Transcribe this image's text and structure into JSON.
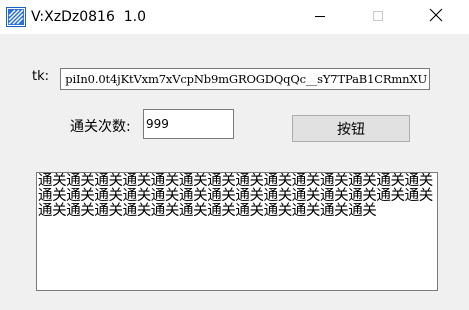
{
  "window": {
    "title": "V:XzDz0816  1.0",
    "icon": "app-icon",
    "controls": {
      "minimize_icon": "minimize-icon",
      "maximize_icon": "maximize-icon",
      "close_icon": "close-icon"
    }
  },
  "form": {
    "tk_label": "tk:",
    "tk_value": "piIn0.0t4jKtVxm7xVcpNb9mGROGDQqQc__sY7TPaB1CRmnXU",
    "count_label": "通关次数:",
    "count_value": "999",
    "button_label": "按钮"
  },
  "output": {
    "text": "通关通关通关通关通关通关通关通关通关通关通关通关通关通关通关通关通关通关通关通关通关通关通关通关通关通关通关通关通关通关通关通关通关通关通关通关通关通关通关通关"
  },
  "colors": {
    "window_bg": "#f0f0f0",
    "titlebar_bg": "#ffffff",
    "button_bg": "#e1e1e1",
    "input_border": "#7a7a7a"
  }
}
